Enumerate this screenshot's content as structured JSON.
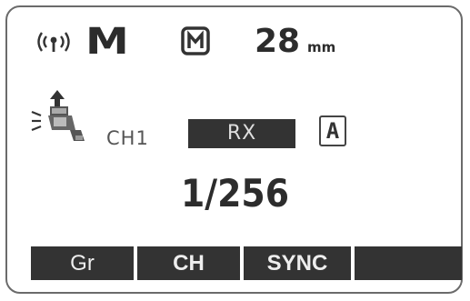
{
  "status_row": {
    "wireless_icon": "wireless-signal-icon",
    "mode": "M",
    "zoom_mode_icon": "manual-zoom-icon",
    "zoom_value": "28",
    "zoom_unit": "mm"
  },
  "radio_row": {
    "slave_icon": "slave-flash-icon",
    "channel": "CH1",
    "role": "RX",
    "group": "A"
  },
  "power_ratio": "1/256",
  "softkeys": [
    {
      "label": "Gr"
    },
    {
      "label": "CH"
    },
    {
      "label": "SYNC"
    },
    {
      "label": ""
    }
  ],
  "colors": {
    "lcd_text": "#2c2c2c",
    "inverse_bg": "#333333",
    "border": "#6b6b6b"
  }
}
